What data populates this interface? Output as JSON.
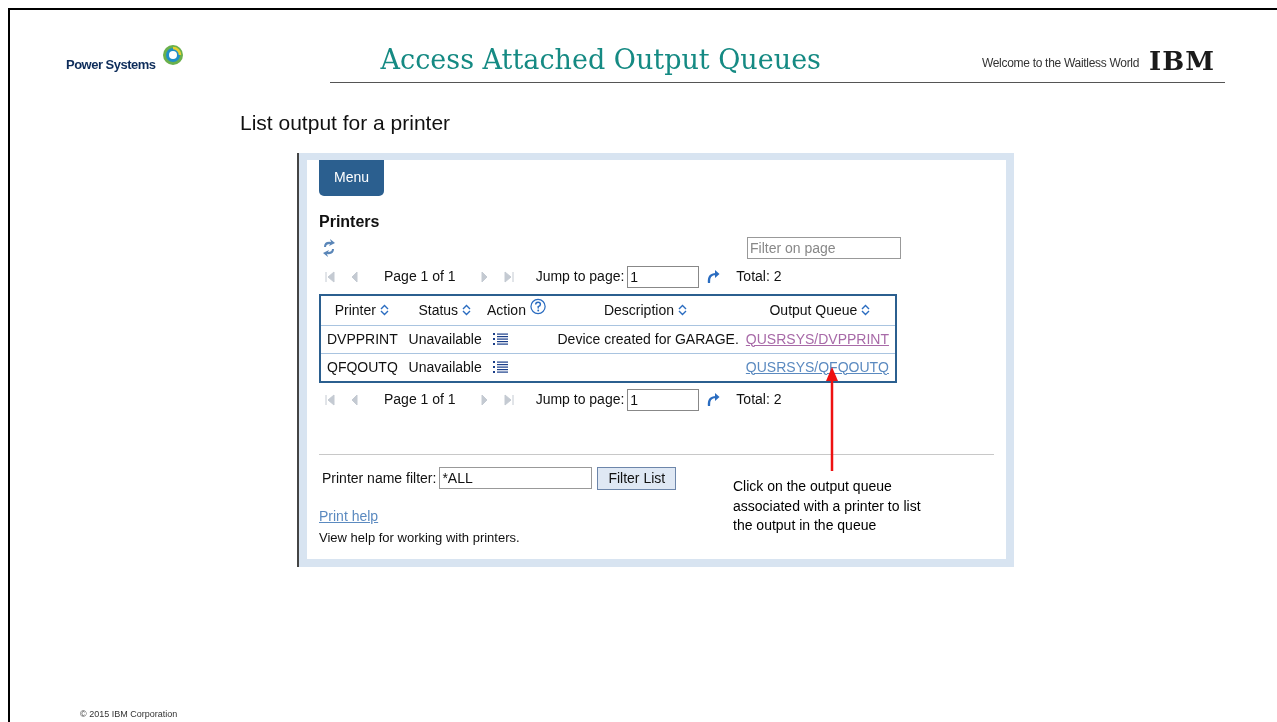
{
  "header": {
    "brand": "Power Systems",
    "title": "Access Attached Output Queues",
    "tagline": "Welcome to the Waitless World",
    "logo": "IBM"
  },
  "subtitle": "List output for a printer",
  "app": {
    "menu_button": "Menu",
    "heading": "Printers",
    "filter_field": {
      "placeholder": "Filter on page"
    },
    "pagers": [
      {
        "page": "Page 1 of 1",
        "jump_label": "Jump to page:",
        "jump_value": "1",
        "total": "Total: 2"
      },
      {
        "page": "Page 1 of 1",
        "jump_label": "Jump to page:",
        "jump_value": "1",
        "total": "Total: 2"
      }
    ],
    "table": {
      "columns": [
        {
          "label": "Printer",
          "kind": "sortable"
        },
        {
          "label": "Status",
          "kind": "sortable"
        },
        {
          "label": "Action",
          "kind": "help"
        },
        {
          "label": "Description",
          "kind": "sortable"
        },
        {
          "label": "Output Queue",
          "kind": "sortable"
        }
      ],
      "rows": [
        {
          "printer": "DVPPRINT",
          "status": "Unavailable",
          "description": "Device created for GARAGE.",
          "output_queue": "QUSRSYS/DVPPRINT",
          "visited": true
        },
        {
          "printer": "QFQOUTQ",
          "status": "Unavailable",
          "output_queue": "QUSRSYS/QFQOUTQ",
          "visited": false
        }
      ]
    },
    "name_filter": {
      "label": "Printer name filter:",
      "value": "*ALL",
      "button": "Filter List"
    },
    "help_link": "Print help",
    "help_text": "View help for working with printers."
  },
  "callout": "Click on the output queue associated with a printer to list the output in the queue",
  "footer": "© 2015 IBM Corporation"
}
